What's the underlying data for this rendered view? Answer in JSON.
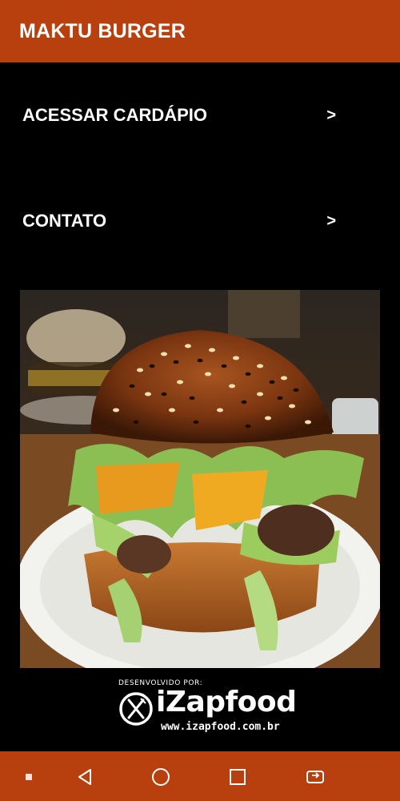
{
  "app": {
    "title": "MAKTU BURGER"
  },
  "menu": {
    "items": [
      {
        "label": "ACESSAR CARDÁPIO",
        "chevron": ">"
      },
      {
        "label": "CONTATO",
        "chevron": ">"
      }
    ]
  },
  "hero": {
    "icon": "burger-photo"
  },
  "developer": {
    "caption": "DESENVOLVIDO POR:",
    "brand": "iZapfood",
    "url": "www.izapfood.com.br"
  },
  "colors": {
    "accent": "#b8400f",
    "background": "#000000",
    "text": "#ffffff"
  },
  "nav": {
    "icons": [
      "square-small-icon",
      "back-triangle-icon",
      "home-circle-icon",
      "recents-square-icon",
      "switch-apps-icon"
    ]
  }
}
